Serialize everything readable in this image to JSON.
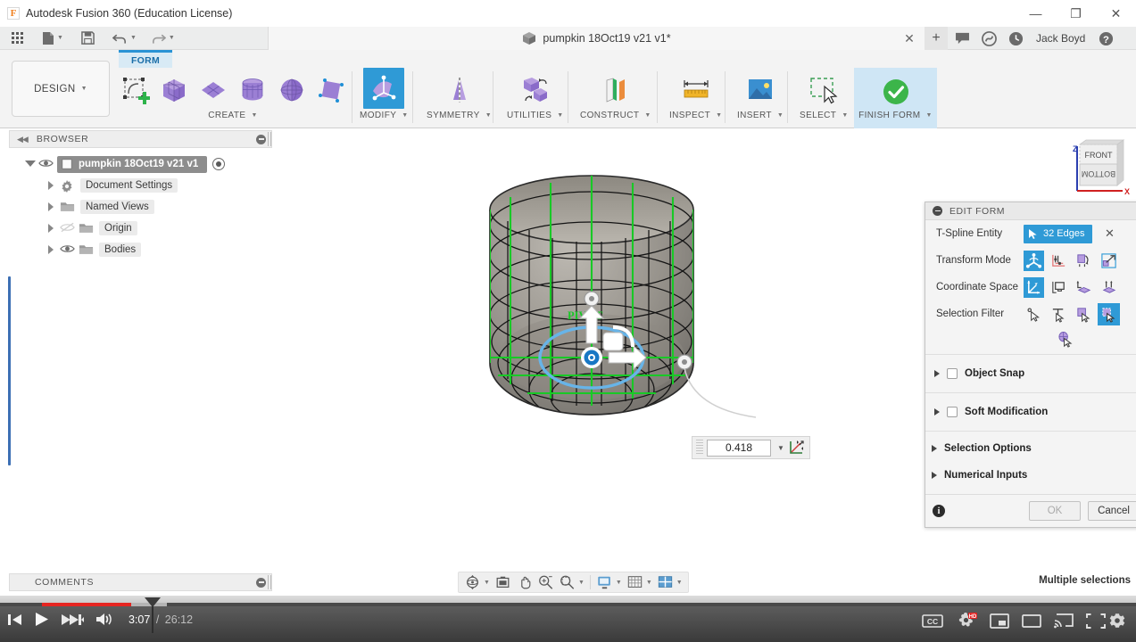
{
  "window": {
    "app_title": "Autodesk Fusion 360 (Education License)",
    "app_icon": "F",
    "minimize_icon": "—",
    "restore_icon": "❐",
    "close_icon": "✕"
  },
  "quick_access": {
    "grid_icon": "grid-icon",
    "new_icon": "new-document-icon",
    "save_icon": "save-icon",
    "undo_icon": "undo-icon",
    "redo_icon": "redo-icon"
  },
  "document_tab": {
    "label": "pumpkin 18Oct19 v21 v1*",
    "close_icon": "✕",
    "add_icon": "+"
  },
  "account_bar": {
    "username": "Jack Boyd",
    "comment_icon": "comment-icon",
    "extension_icon": "extension-icon",
    "history_icon": "history-icon",
    "help_icon": "?"
  },
  "ribbon": {
    "tab_label": "FORM",
    "workspace_label": "DESIGN",
    "panels": [
      {
        "label": "CREATE",
        "tools": [
          "form-create-icon",
          "box-icon",
          "plane-icon",
          "cylinder-icon",
          "sphere-icon",
          "quadball-icon"
        ]
      },
      {
        "label": "MODIFY",
        "tools": [
          "modify-edit-form-icon"
        ]
      },
      {
        "label": "SYMMETRY",
        "tools": [
          "symmetry-mirror-icon"
        ]
      },
      {
        "label": "UTILITIES",
        "tools": [
          "utilities-convert-icon"
        ]
      },
      {
        "label": "CONSTRUCT",
        "tools": [
          "construct-plane-icon"
        ]
      },
      {
        "label": "INSPECT",
        "tools": [
          "inspect-measure-icon"
        ]
      },
      {
        "label": "INSERT",
        "tools": [
          "insert-image-icon"
        ]
      },
      {
        "label": "SELECT",
        "tools": [
          "select-window-icon"
        ]
      },
      {
        "label": "FINISH FORM",
        "tools": [
          "finish-form-check-icon"
        ]
      }
    ]
  },
  "browser": {
    "title": "BROWSER",
    "collapse_icon": "◀◀",
    "items": [
      {
        "label": "pumpkin 18Oct19 v21 v1",
        "level": 0,
        "icon": "component-icon",
        "eye": "visible",
        "expander": "expanded",
        "root": true
      },
      {
        "label": "Document Settings",
        "level": 1,
        "icon": "gear-icon",
        "eye": "none",
        "expander": "collapsed"
      },
      {
        "label": "Named Views",
        "level": 1,
        "icon": "folder-icon",
        "eye": "none",
        "expander": "collapsed"
      },
      {
        "label": "Origin",
        "level": 1,
        "icon": "folder-icon",
        "eye": "hidden",
        "expander": "collapsed"
      },
      {
        "label": "Bodies",
        "level": 1,
        "icon": "folder-icon",
        "eye": "visible",
        "expander": "collapsed"
      }
    ]
  },
  "canvas": {
    "pivot_label": "PIVOT",
    "value_field": "0.418",
    "value_dropdown_icon": "▾",
    "coordinate_icon": "coordinate-move-icon",
    "viewcube": {
      "front_face": "FRONT",
      "bottom_face": "BOTTOM",
      "axis_z": "Z",
      "axis_x": "X"
    }
  },
  "dialog": {
    "title": "EDIT FORM",
    "rows": [
      {
        "label": "T-Spline Entity",
        "value": "32 Edges",
        "type": "selection"
      },
      {
        "label": "Transform Mode",
        "type": "iconset",
        "count": 4,
        "selected": 0
      },
      {
        "label": "Coordinate Space",
        "type": "iconset",
        "count": 4,
        "selected": 0
      },
      {
        "label": "Selection Filter",
        "type": "iconset",
        "count": 4,
        "selected": 3
      }
    ],
    "transform_icons": [
      "transform-freeform-icon",
      "transform-axis-icon",
      "transform-rotate-icon",
      "transform-scale-icon"
    ],
    "coordinate_icons": [
      "coord-world-icon",
      "coord-view-icon",
      "coord-face-icon",
      "coord-normal-icon"
    ],
    "filter_icons": [
      "filter-vertex-icon",
      "filter-edge-icon",
      "filter-face-icon",
      "filter-body-icon"
    ],
    "filter_extra_icon": "filter-form-icon",
    "clear_icon": "✕",
    "groups": [
      {
        "label": "Object Snap",
        "checkbox": true,
        "expanded": false
      },
      {
        "label": "Soft Modification",
        "checkbox": true,
        "expanded": false
      },
      {
        "label": "Selection Options",
        "checkbox": false,
        "expanded": false
      },
      {
        "label": "Numerical Inputs",
        "checkbox": false,
        "expanded": false
      }
    ],
    "info_icon": "i",
    "ok_label": "OK",
    "cancel_label": "Cancel"
  },
  "footer": {
    "comments_title": "COMMENTS",
    "status_text": "Multiple selections",
    "nav_tools": [
      "orbit-icon",
      "display-settings-icon",
      "pan-icon",
      "zoom-icon",
      "zoom-window-icon",
      "display-mode-icon",
      "grid-snap-icon",
      "viewports-icon"
    ]
  },
  "player": {
    "current_time": "3:07",
    "separator": "/",
    "total_time": "26:12",
    "prev_icon": "previous-icon",
    "play_icon": "play-icon",
    "next_icon": "next-icon",
    "volume_icon": "volume-icon",
    "captions_icon": "CC",
    "quality_icon": "HD",
    "miniplayer_icon": "miniplayer-icon",
    "theater_icon": "theater-icon",
    "cast_icon": "cast-icon",
    "fullscreen_icon": "fullscreen-icon",
    "settings_icon": "settings-gear-icon"
  },
  "colors": {
    "accent_blue": "#2f9ad6",
    "tab_blue": "#2a93d5",
    "finish_green": "#3cb54a",
    "progress_red": "#e52521",
    "purple": "#9b7fd4"
  }
}
